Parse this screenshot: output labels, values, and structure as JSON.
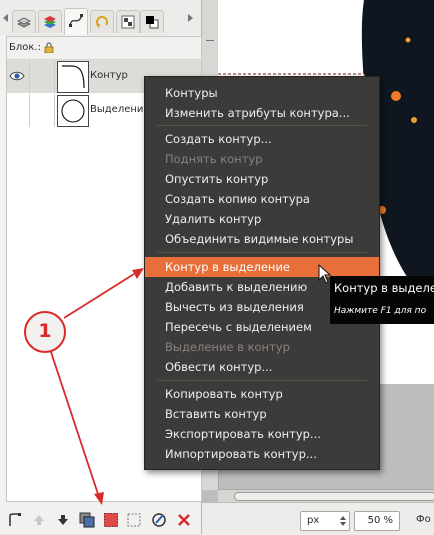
{
  "dock": {
    "lock_label": "Блок.:",
    "paths": [
      {
        "name": "Контур",
        "selected": true
      },
      {
        "name": "Выделение",
        "selected": false
      }
    ]
  },
  "menu": {
    "items": [
      {
        "label": "Контуры",
        "state": "enabled"
      },
      {
        "label": "Изменить атрибуты контура...",
        "state": "enabled"
      },
      {
        "label": "Создать контур...",
        "state": "enabled"
      },
      {
        "label": "Поднять контур",
        "state": "disabled"
      },
      {
        "label": "Опустить контур",
        "state": "enabled"
      },
      {
        "label": "Создать копию контура",
        "state": "enabled"
      },
      {
        "label": "Удалить контур",
        "state": "enabled"
      },
      {
        "label": "Объединить видимые контуры",
        "state": "enabled"
      },
      {
        "label": "Контур в выделение",
        "state": "highlighted"
      },
      {
        "label": "Добавить к выделению",
        "state": "enabled"
      },
      {
        "label": "Вычесть из выделения",
        "state": "enabled"
      },
      {
        "label": "Пересечь с выделением",
        "state": "enabled"
      },
      {
        "label": "Выделение в контур",
        "state": "disabled"
      },
      {
        "label": "Обвести контур...",
        "state": "enabled"
      },
      {
        "label": "Копировать контур",
        "state": "enabled"
      },
      {
        "label": "Вставить контур",
        "state": "enabled"
      },
      {
        "label": "Экспортировать контур...",
        "state": "enabled"
      },
      {
        "label": "Импортировать контур...",
        "state": "enabled"
      }
    ]
  },
  "tooltip": {
    "title": "Контур в выделение",
    "hint": "Нажмите F1 для по"
  },
  "status": {
    "unit": "px",
    "zoom": "50 %",
    "text": "Фо"
  },
  "annotation": {
    "marker": "1"
  },
  "colors": {
    "menu_bg": "#3d3b39",
    "menu_highlight": "#e86f3a",
    "annotation_red": "#d82a2a"
  },
  "icons": [
    "eye-icon",
    "lock-icon",
    "layers-icon",
    "channels-icon",
    "paths-icon",
    "undo-history-icon",
    "brushes-icon",
    "colors-icon",
    "new-path-icon",
    "raise-path-icon",
    "lower-path-icon",
    "duplicate-path-icon",
    "path-to-selection-icon",
    "selection-to-path-icon",
    "stroke-path-icon",
    "delete-path-icon",
    "mouse-cursor-icon"
  ]
}
